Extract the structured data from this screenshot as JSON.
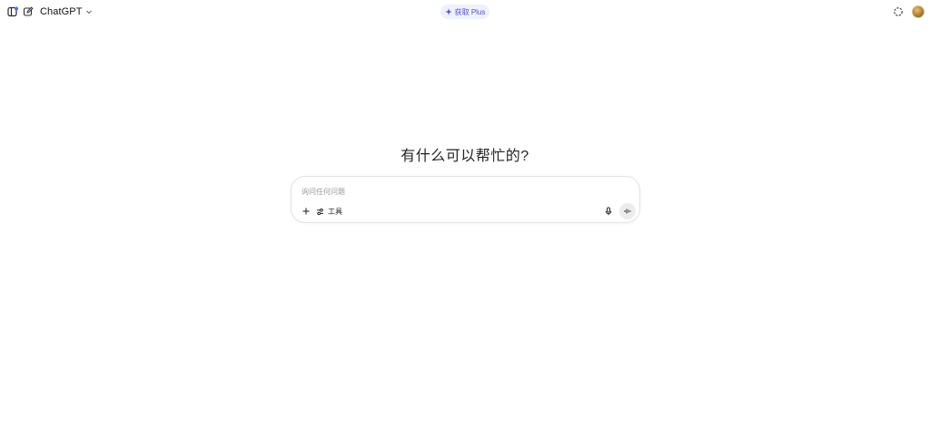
{
  "topbar": {
    "model_name": "ChatGPT",
    "upgrade_label": "获取 Plus",
    "icons": {
      "sidebar": "sidebar-toggle-icon",
      "new_chat": "new-chat-icon",
      "model_chevron": "chevron-down-icon",
      "sparkle": "sparkle-icon",
      "temporary_chat": "temporary-chat-icon"
    }
  },
  "main": {
    "headline": "有什么可以帮忙的?"
  },
  "composer": {
    "placeholder": "询问任何问题",
    "tools_label": "工具",
    "icons": {
      "attach": "plus-icon",
      "tools": "tools-icon",
      "mic": "microphone-icon",
      "voice": "voice-mode-icon"
    }
  },
  "colors": {
    "accent": "#5a4fc8",
    "pill_bg": "#eef0fb",
    "border": "#e3e3e3"
  }
}
